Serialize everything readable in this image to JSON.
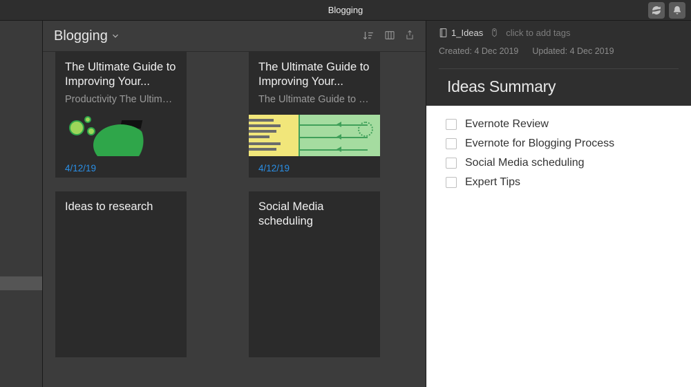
{
  "window": {
    "title": "Blogging"
  },
  "notebook": {
    "name": "Blogging"
  },
  "cards": [
    {
      "heading": "The Ultimate Guide to Improving Your...",
      "snippet": "Productivity The Ultimat...",
      "date": "4/12/19"
    },
    {
      "heading": "The Ultimate Guide to Improving Your...",
      "snippet": "The Ultimate Guide to Im...",
      "date": "4/12/19"
    },
    {
      "heading": "Ideas to research",
      "snippet": "",
      "date": ""
    },
    {
      "heading": "Social Media scheduling",
      "snippet": "",
      "date": ""
    }
  ],
  "note": {
    "notebook": "1_Ideas",
    "tags_hint": "click to add tags",
    "created_label": "Created:",
    "created_value": "4 Dec 2019",
    "updated_label": "Updated:",
    "updated_value": "4 Dec 2019",
    "title": "Ideas Summary",
    "checklist": [
      "Evernote Review",
      "Evernote for Blogging Process",
      "Social Media scheduling",
      "Expert Tips"
    ]
  }
}
